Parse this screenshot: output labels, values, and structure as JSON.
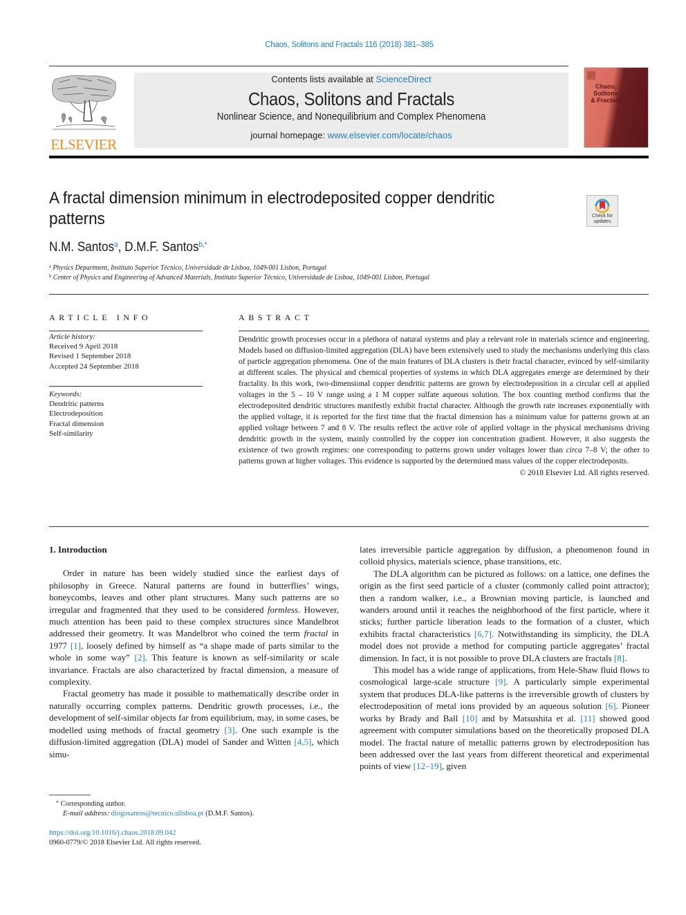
{
  "running_head": "Chaos, Solitons and Fractals 116 (2018) 381–385",
  "publisher": {
    "wordmark": "ELSEVIER",
    "logo_icon": "elsevier-tree-icon"
  },
  "masthead": {
    "contents_prefix": "Contents lists available at ",
    "contents_link": "ScienceDirect",
    "journal_title": "Chaos, Solitons and Fractals",
    "journal_subtitle": "Nonlinear Science, and Nonequilibrium and Complex Phenomena",
    "homepage_prefix": "journal homepage: ",
    "homepage_link": "www.elsevier.com/locate/chaos"
  },
  "cover": {
    "title_lines": [
      "Chaos,",
      "Solitons",
      "& Fractals"
    ]
  },
  "check_updates": {
    "label_line1": "Check for",
    "label_line2": "updates"
  },
  "article": {
    "title_line1": "A fractal dimension minimum in electrodeposited copper dendritic",
    "title_line2": "patterns",
    "authors": [
      {
        "name": "N.M. Santos",
        "sup": "a"
      },
      {
        "name": "D.M.F. Santos",
        "sup": "b,*"
      }
    ],
    "author_separator": ", ",
    "affiliations": [
      {
        "sup": "a",
        "text": "Physics Department, Instituto Superior Técnico, Universidade de Lisboa, 1049-001 Lisbon, Portugal"
      },
      {
        "sup": "b",
        "text": "Center of Physics and Engineering of Advanced Materials, Instituto Superior Técnico, Universidade de Lisboa, 1049-001 Lisbon, Portugal"
      }
    ]
  },
  "article_info": {
    "heading": "ARTICLE INFO",
    "history_label": "Article history:",
    "history": [
      "Received 9 April 2018",
      "Revised 1 September 2018",
      "Accepted 24 September 2018"
    ],
    "keywords_label": "Keywords:",
    "keywords": [
      "Dendritic patterns",
      "Electrodeposition",
      "Fractal dimension",
      "Self-similarity"
    ]
  },
  "abstract": {
    "heading": "ABSTRACT",
    "text_1": "Dendritic growth processes occur in a plethora of natural systems and play a relevant role in materials science and engineering. Models based on diffusion-limited aggregation (DLA) have been extensively used to study the mechanisms underlying this class of particle aggregation phenomena. One of the main features of DLA clusters is their fractal character, evinced by self-similarity at different scales. The physical and chemical properties of systems in which DLA aggregates emerge are determined by their fractality. In this work, two-dimensional copper dendritic patterns are grown by electrodeposition in a circular cell at applied voltages in the 5 – 10 V range using a 1 M copper sulfate aqueous solution. The box counting method confirms that the electrodeposited dendritic structures manifestly exhibit fractal character. Although the growth rate increases exponentially with the applied voltage, it is reported for the first time that the fractal dimension has a minimum value for patterns grown at an applied voltage between 7 and 8 V. The results reflect the active role of applied voltage in the physical mechanisms driving dendritic growth in the system, mainly controlled by the copper ion concentration gradient. However, it also suggests the existence of two growth regimes: one corresponding to patterns grown under voltages lower than ",
    "text_italic": "circa",
    "text_2": " 7–8 V; the other to patterns grown at higher voltages. This evidence is supported by the determined mass values of the copper electrodeposits.",
    "copyright": "© 2018 Elsevier Ltd. All rights reserved."
  },
  "intro": {
    "heading": "1. Introduction",
    "p1_a": "Order in nature has been widely studied since the earliest days of philosophy in Greece. Natural patterns are found in butterflies’ wings, honeycombs, leaves and other plant structures. Many such patterns are so irregular and fragmented that they used to be considered ",
    "p1_i1": "formless",
    "p1_b": ". However, much attention has been paid to these complex structures since Mandelbrot addressed their geometry. It was Mandelbrot who coined the term ",
    "p1_i2": "fractal",
    "p1_c": " in 1977 ",
    "p1_ref1": "[1]",
    "p1_d": ", loosely defined by himself as “a shape made of parts similar to the whole in some way” ",
    "p1_ref2": "[2]",
    "p1_e": ". This feature is known as self-similarity or scale invariance. Fractals are also characterized by fractal dimension, a measure of complexity.",
    "p2_a": "Fractal geometry has made it possible to mathematically describe order in naturally occurring complex patterns. Dendritic growth processes, i.e., the development of self-similar objects far from equilibrium, may, in some cases, be modelled using methods of fractal geometry ",
    "p2_ref1": "[3]",
    "p2_b": ". One such example is the diffusion-limited aggregation (DLA) model of Sander and Witten ",
    "p2_ref2": "[4,5]",
    "p2_c": ", which simulates irreversible particle aggregation by diffusion, a phenomenon found in colloid physics, materials science, phase transitions, etc.",
    "p3_a": "The DLA algorithm can be pictured as follows: on a lattice, one defines the origin as the first seed particle of a cluster (commonly called point attractor); then a random walker, i.e., a Brownian moving particle, is launched and wanders around until it reaches the neighborhood of the first particle, where it sticks; further particle liberation leads to the formation of a cluster, which exhibits fractal characteristics ",
    "p3_ref1": "[6,7]",
    "p3_b": ". Notwithstanding its simplicity, the DLA model does not provide a method for computing particle aggregates’ fractal dimension. In fact, it is not possible to prove DLA clusters are fractals ",
    "p3_ref2": "[8]",
    "p3_c": ".",
    "p4_a": "This model has a wide range of applications, from Hele-Shaw fluid flows to cosmological large-scale structure ",
    "p4_ref1": "[9]",
    "p4_b": ". A particularly simple experimental system that produces DLA-like patterns is the irreversible growth of clusters by electrodeposition of metal ions provided by an aqueous solution ",
    "p4_ref2": "[6]",
    "p4_c": ". Pioneer works by Brady and Ball ",
    "p4_ref3": "[10]",
    "p4_d": " and by Matsushita et al. ",
    "p4_ref4": "[11]",
    "p4_e": " showed good agreement with computer simulations based on the theoretically proposed DLA model. The fractal nature of metallic patterns grown by electrodeposition has been addressed over the last years from different theoretical and experimental points of view ",
    "p4_ref5": "[12–19]",
    "p4_f": ", given"
  },
  "footnotes": {
    "corresponding_mark": "*",
    "corresponding": "Corresponding author.",
    "email_label": "E-mail address: ",
    "email": "diogosantos@tecnico.ulisboa.pt",
    "email_suffix": " (D.M.F. Santos).",
    "doi": "https://doi.org/10.1016/j.chaos.2018.09.042",
    "issn": "0960-0779/© 2018 Elsevier Ltd. All rights reserved."
  }
}
